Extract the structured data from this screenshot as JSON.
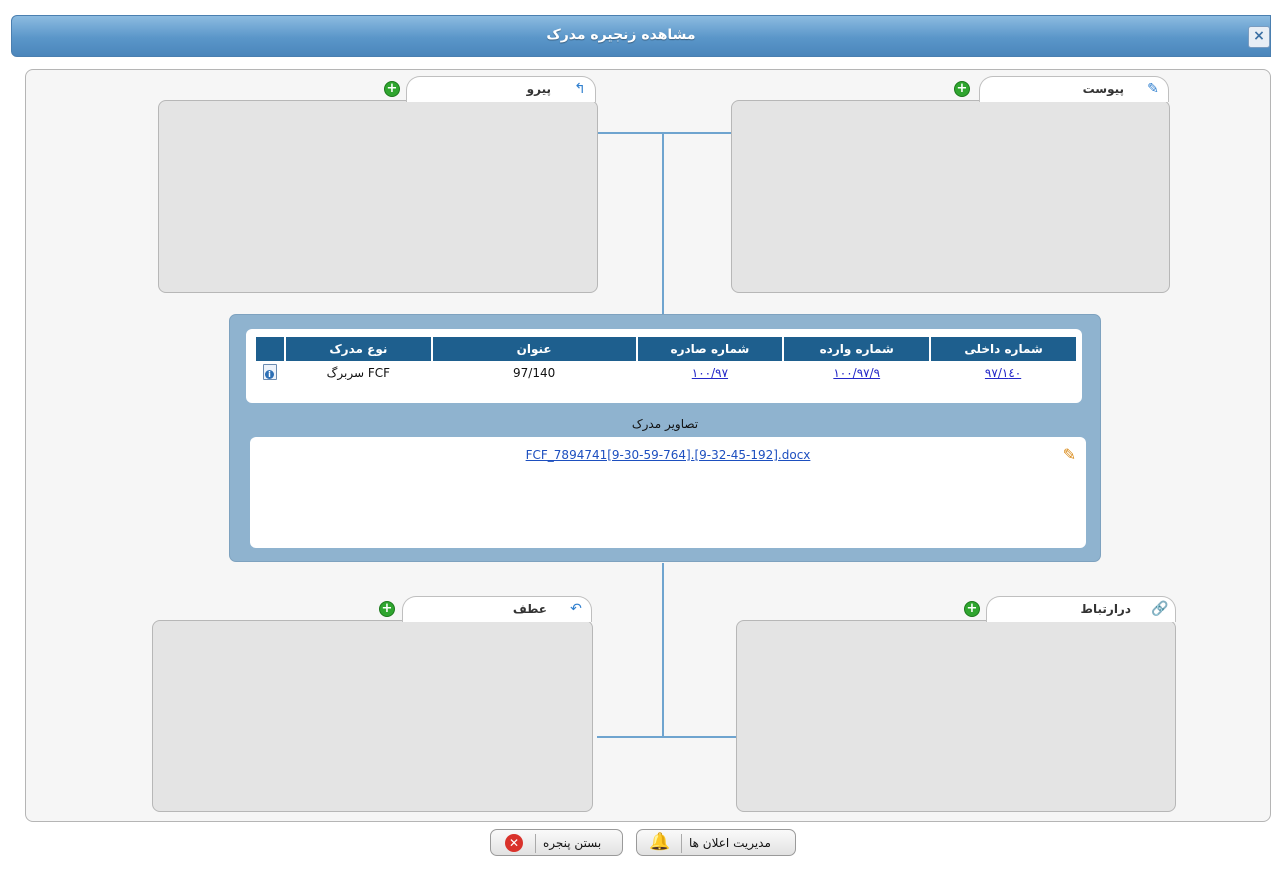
{
  "window": {
    "title": "مشاهده زنجیره مدرک",
    "close_label": "×"
  },
  "groups": {
    "pirou": {
      "label": "پیرو",
      "icon": "follow-up-doc-icon"
    },
    "peyvast": {
      "label": "پیوست",
      "icon": "attachment-doc-icon"
    },
    "atf": {
      "label": "عطف",
      "icon": "reference-arrow-icon"
    },
    "dar_ertebat": {
      "label": "درارتباط",
      "icon": "link-icon"
    }
  },
  "document_table": {
    "columns": [
      "شماره داخلی",
      "شماره وارده",
      "شماره صادره",
      "عنوان",
      "نوع مدرک"
    ],
    "rows": [
      {
        "internal_no": "۹۷/۱٤٠",
        "incoming_no": "۱۰۰/۹۷/۹",
        "outgoing_no": "۱۰۰/۹۷",
        "title": "97/140",
        "doc_type": "سربرگ FCF",
        "icon": "document-info-icon"
      }
    ]
  },
  "images": {
    "title": "تصاویر مدرک",
    "file_name": "FCF_7894741[9-30-59-764].[9-32-45-192].docx",
    "icon": "paperclip-icon"
  },
  "buttons": {
    "close_window": "بستن پنجره",
    "manage_notifications": "مدیریت اعلان ها"
  },
  "colors": {
    "titlebar": "#5a96c9",
    "table_header": "#1e5f8e",
    "center_panel": "#8fb3cf",
    "connector": "#6fa4cf",
    "add_button": "#2fa52f",
    "close_icon": "#d9322b"
  }
}
